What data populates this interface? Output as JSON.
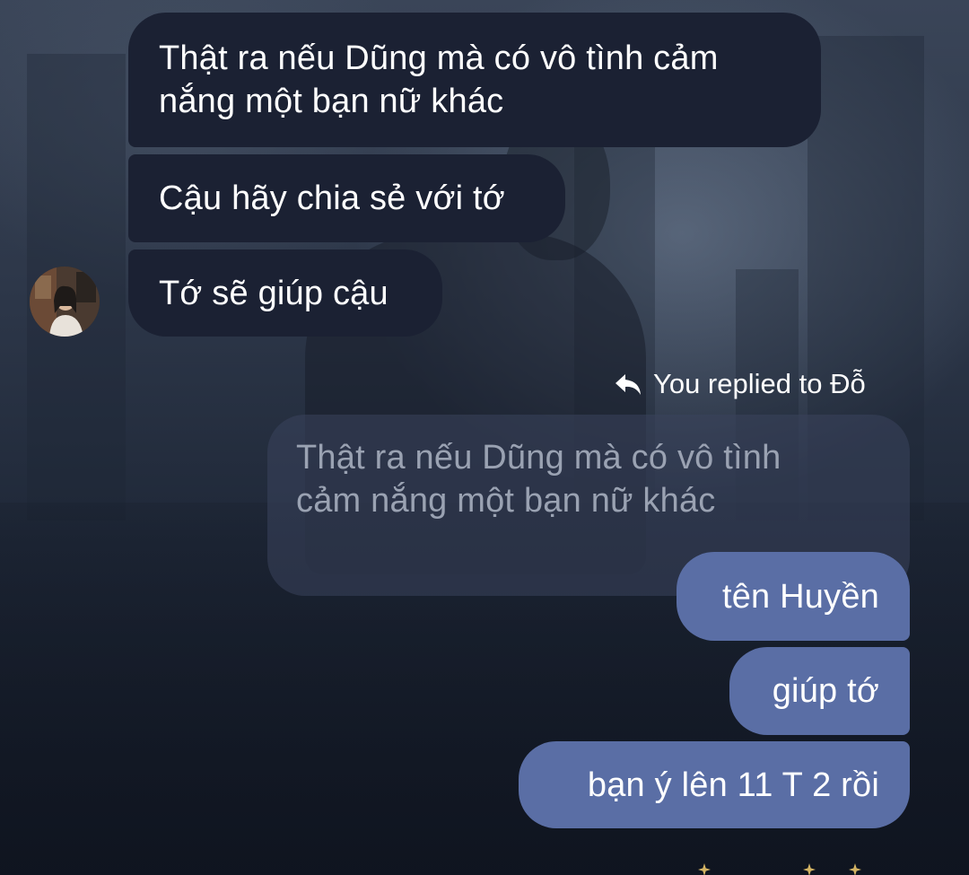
{
  "conversation": {
    "incoming": [
      {
        "text": "Thật ra nếu Dũng mà có vô tình cảm\nnắng một bạn nữ khác"
      },
      {
        "text": "Cậu hãy chia sẻ với tớ"
      },
      {
        "text": "Tớ sẽ giúp cậu"
      }
    ],
    "reply_note": "You replied to Đỗ",
    "quoted_text": "Thật ra nếu Dũng mà có vô tình\ncảm nắng một bạn nữ khác",
    "outgoing": [
      {
        "text": "tên Huyền"
      },
      {
        "text": "giúp tớ"
      },
      {
        "text": "bạn ý lên 11 T 2 rồi"
      }
    ]
  },
  "icons": {
    "avatar": "contact-avatar-photo",
    "reply": "reply-arrow-icon"
  },
  "colors": {
    "incoming_bubble": "#1b2133",
    "outgoing_bubble": "#5a6ea5",
    "quoted_bubble": "#3a445c",
    "quoted_text": "#9aa2b2",
    "text": "#ffffff"
  }
}
